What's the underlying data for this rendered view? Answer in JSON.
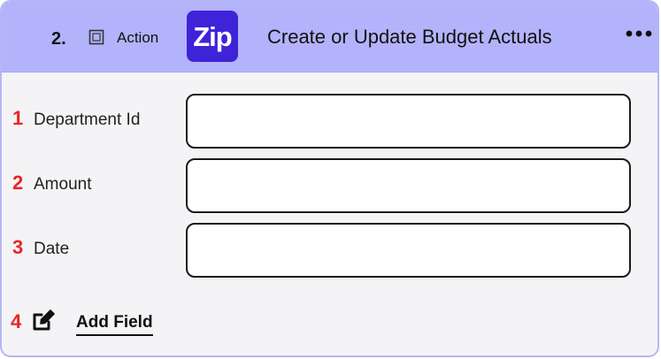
{
  "step": {
    "number": "2.",
    "type_label": "Action",
    "app_logo_text": "Zip",
    "title": "Create or Update Budget Actuals"
  },
  "colors": {
    "header_background": "#b3b3fb",
    "card_background": "#f4f4f6",
    "app_logo_background": "#3f23d8",
    "annotation_numbers": "#ea2525"
  },
  "fields": [
    {
      "number": "1",
      "label": "Department Id",
      "value": ""
    },
    {
      "number": "2",
      "label": "Amount",
      "value": ""
    },
    {
      "number": "3",
      "label": "Date",
      "value": ""
    }
  ],
  "add_field": {
    "number": "4",
    "label": "Add Field",
    "icon": "edit-icon"
  },
  "icons": {
    "step_type": "checkbox-square-icon",
    "more_options": "ellipsis-horizontal-icon"
  }
}
